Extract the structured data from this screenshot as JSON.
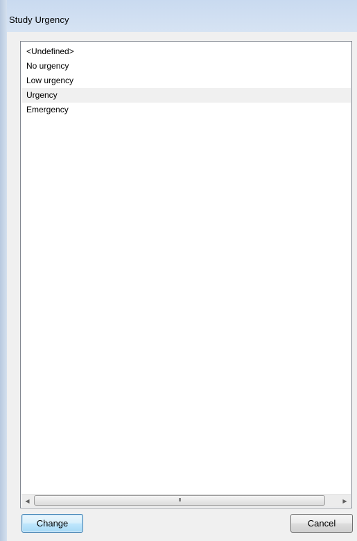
{
  "window": {
    "title": "Study Urgency"
  },
  "list": {
    "items": [
      {
        "label": "<Undefined>",
        "selected": false
      },
      {
        "label": "No urgency",
        "selected": false
      },
      {
        "label": "Low urgency",
        "selected": false
      },
      {
        "label": "Urgency",
        "selected": true
      },
      {
        "label": "Emergency",
        "selected": false
      }
    ]
  },
  "scrollbar": {
    "left_arrow": "◀",
    "right_arrow": "▶",
    "grip": "III"
  },
  "buttons": {
    "change_label": "Change",
    "cancel_label": "Cancel"
  },
  "colors": {
    "selection": "#f0f0f0",
    "default_button_border": "#3c7fb1"
  }
}
